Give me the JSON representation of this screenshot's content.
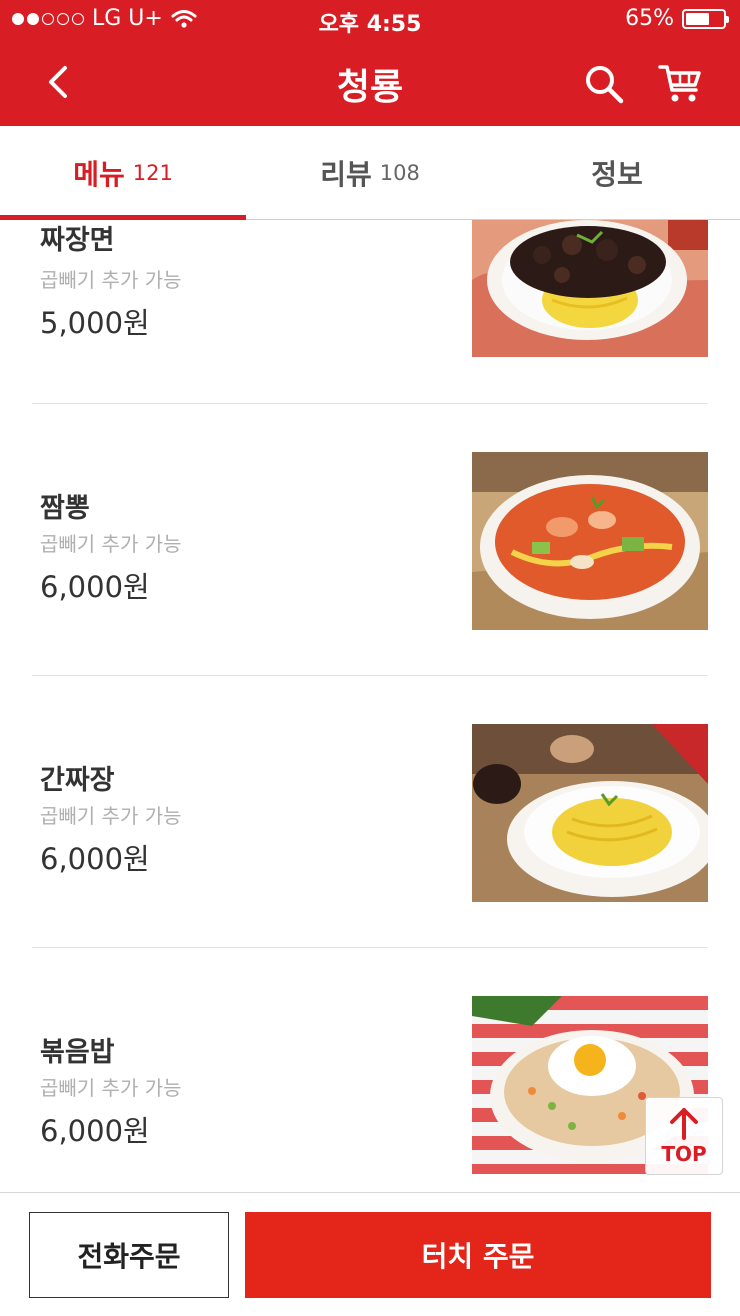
{
  "status_bar": {
    "carrier": "LG U+",
    "time": "오후 4:55",
    "battery": "65%",
    "battery_level": 0.65
  },
  "header": {
    "title": "청룡"
  },
  "tabs": [
    {
      "label": "메뉴",
      "count": "121",
      "active": true
    },
    {
      "label": "리뷰",
      "count": "108",
      "active": false
    },
    {
      "label": "정보",
      "count": "",
      "active": false
    }
  ],
  "menu_items": [
    {
      "name": "짜장면",
      "note": "곱빼기 추가 가능",
      "price": "5,000원"
    },
    {
      "name": "짬뽕",
      "note": "곱빼기 추가 가능",
      "price": "6,000원"
    },
    {
      "name": "간짜장",
      "note": "곱빼기 추가 가능",
      "price": "6,000원"
    },
    {
      "name": "볶음밥",
      "note": "곱빼기 추가 가능",
      "price": "6,000원"
    }
  ],
  "top_button": {
    "label": "TOP"
  },
  "bottom": {
    "phone_order": "전화주문",
    "touch_order": "터치 주문"
  },
  "colors": {
    "brand_red": "#d81e24",
    "order_red": "#e4261a"
  }
}
